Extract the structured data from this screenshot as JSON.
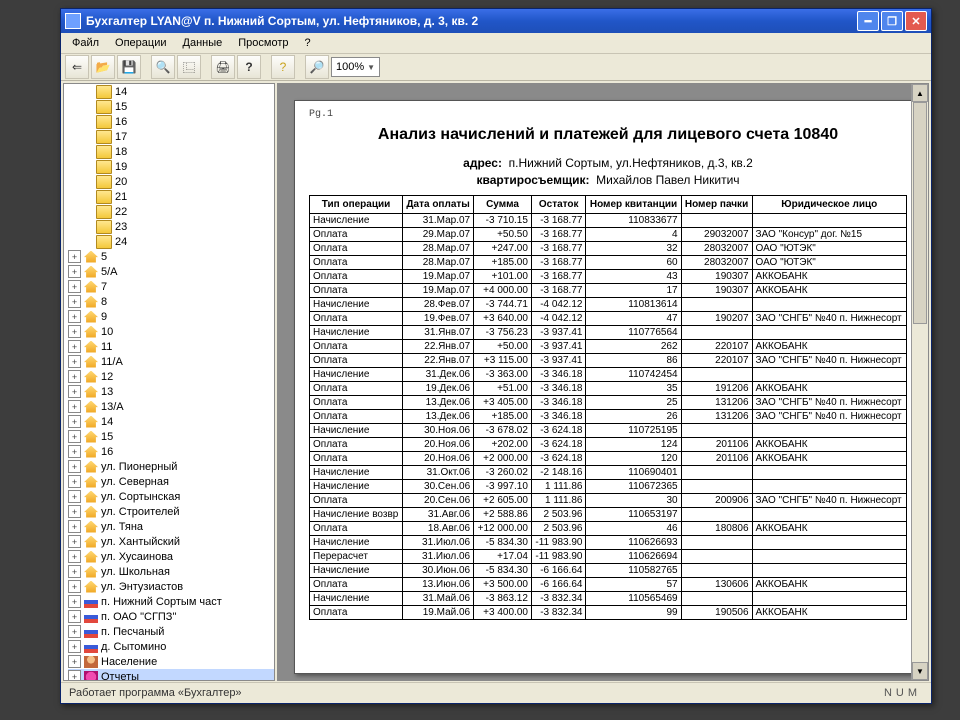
{
  "title": "Бухгалтер LYAN@V п. Нижний Сортым, ул. Нефтяников, д. 3, кв. 2",
  "menu": [
    "Файл",
    "Операции",
    "Данные",
    "Просмотр",
    "?"
  ],
  "toolbar": {
    "zoom": "100%"
  },
  "status": {
    "left": "Работает программа «Бухгалтер»",
    "right": "NUM"
  },
  "tree": {
    "top_folders": [
      "14",
      "15",
      "16",
      "17",
      "18",
      "19",
      "20",
      "21",
      "22",
      "23",
      "24"
    ],
    "houses": [
      "5",
      "5/А",
      "7",
      "8",
      "9",
      "10",
      "11",
      "11/А",
      "12",
      "13",
      "13/А",
      "14",
      "15",
      "16"
    ],
    "streets": [
      "ул. Пионерный",
      "ул. Северная",
      "ул. Сортынская",
      "ул. Строителей",
      "ул. Тяна",
      "ул. Хантыйский",
      "ул. Хусаинова",
      "ул. Школьная",
      "ул. Энтузиастов"
    ],
    "flags": [
      "п. Нижний Сортым част",
      "п. ОАО \"СГПЗ\"",
      "п. Песчаный",
      "д. Сытомино"
    ],
    "extra": [
      {
        "label": "Население",
        "icon": "person"
      },
      {
        "label": "Отчеты",
        "icon": "report",
        "selected": true
      }
    ]
  },
  "doc": {
    "pg": "Pg.1",
    "title": "Анализ начислений и платежей для лицевого счета 10840",
    "addr_label": "адрес:",
    "addr": "п.Нижний Сортым, ул.Нефтяников, д.3, кв.2",
    "tenant_label": "квартиросъемщик:",
    "tenant": "Михайлов Павел Никитич",
    "columns": [
      "Тип операции",
      "Дата оплаты",
      "Сумма",
      "Остаток",
      "Номер квитанции",
      "Номер пачки",
      "Юридическое лицо"
    ],
    "rows": [
      [
        "Начисление",
        "31.Мар.07",
        "-3 710.15",
        "-3 168.77",
        "110833677",
        "",
        ""
      ],
      [
        "Оплата",
        "29.Мар.07",
        "+50.50",
        "-3 168.77",
        "4",
        "29032007",
        "ЗАО \"Консур\" дог. №15"
      ],
      [
        "Оплата",
        "28.Мар.07",
        "+247.00",
        "-3 168.77",
        "32",
        "28032007",
        "ОАО \"ЮТЭК\""
      ],
      [
        "Оплата",
        "28.Мар.07",
        "+185.00",
        "-3 168.77",
        "60",
        "28032007",
        "ОАО \"ЮТЭК\""
      ],
      [
        "Оплата",
        "19.Мар.07",
        "+101.00",
        "-3 168.77",
        "43",
        "190307",
        "АККОБАНК"
      ],
      [
        "Оплата",
        "19.Мар.07",
        "+4 000.00",
        "-3 168.77",
        "17",
        "190307",
        "АККОБАНК"
      ],
      [
        "Начисление",
        "28.Фев.07",
        "-3 744.71",
        "-4 042.12",
        "110813614",
        "",
        ""
      ],
      [
        "Оплата",
        "19.Фев.07",
        "+3 640.00",
        "-4 042.12",
        "47",
        "190207",
        "ЗАО \"СНГБ\" №40 п. Нижнесорт"
      ],
      [
        "Начисление",
        "31.Янв.07",
        "-3 756.23",
        "-3 937.41",
        "110776564",
        "",
        ""
      ],
      [
        "Оплата",
        "22.Янв.07",
        "+50.00",
        "-3 937.41",
        "262",
        "220107",
        "АККОБАНК"
      ],
      [
        "Оплата",
        "22.Янв.07",
        "+3 115.00",
        "-3 937.41",
        "86",
        "220107",
        "ЗАО \"СНГБ\" №40 п. Нижнесорт"
      ],
      [
        "Начисление",
        "31.Дек.06",
        "-3 363.00",
        "-3 346.18",
        "110742454",
        "",
        ""
      ],
      [
        "Оплата",
        "19.Дек.06",
        "+51.00",
        "-3 346.18",
        "35",
        "191206",
        "АККОБАНК"
      ],
      [
        "Оплата",
        "13.Дек.06",
        "+3 405.00",
        "-3 346.18",
        "25",
        "131206",
        "ЗАО \"СНГБ\" №40 п. Нижнесорт"
      ],
      [
        "Оплата",
        "13.Дек.06",
        "+185.00",
        "-3 346.18",
        "26",
        "131206",
        "ЗАО \"СНГБ\" №40 п. Нижнесорт"
      ],
      [
        "Начисление",
        "30.Ноя.06",
        "-3 678.02",
        "-3 624.18",
        "110725195",
        "",
        ""
      ],
      [
        "Оплата",
        "20.Ноя.06",
        "+202.00",
        "-3 624.18",
        "124",
        "201106",
        "АККОБАНК"
      ],
      [
        "Оплата",
        "20.Ноя.06",
        "+2 000.00",
        "-3 624.18",
        "120",
        "201106",
        "АККОБАНК"
      ],
      [
        "Начисление",
        "31.Окт.06",
        "-3 260.02",
        "-2 148.16",
        "110690401",
        "",
        ""
      ],
      [
        "Начисление",
        "30.Сен.06",
        "-3 997.10",
        "1 111.86",
        "110672365",
        "",
        ""
      ],
      [
        "Оплата",
        "20.Сен.06",
        "+2 605.00",
        "1 111.86",
        "30",
        "200906",
        "ЗАО \"СНГБ\" №40 п. Нижнесорт"
      ],
      [
        "Начисление возвр",
        "31.Авг.06",
        "+2 588.86",
        "2 503.96",
        "110653197",
        "",
        ""
      ],
      [
        "Оплата",
        "18.Авг.06",
        "+12 000.00",
        "2 503.96",
        "46",
        "180806",
        "АККОБАНК"
      ],
      [
        "Начисление",
        "31.Июл.06",
        "-5 834.30",
        "-11 983.90",
        "110626693",
        "",
        ""
      ],
      [
        "Перерасчет",
        "31.Июл.06",
        "+17.04",
        "-11 983.90",
        "110626694",
        "",
        ""
      ],
      [
        "Начисление",
        "30.Июн.06",
        "-5 834.30",
        "-6 166.64",
        "110582765",
        "",
        ""
      ],
      [
        "Оплата",
        "13.Июн.06",
        "+3 500.00",
        "-6 166.64",
        "57",
        "130606",
        "АККОБАНК"
      ],
      [
        "Начисление",
        "31.Май.06",
        "-3 863.12",
        "-3 832.34",
        "110565469",
        "",
        ""
      ],
      [
        "Оплата",
        "19.Май.06",
        "+3 400.00",
        "-3 832.34",
        "99",
        "190506",
        "АККОБАНК"
      ]
    ]
  }
}
